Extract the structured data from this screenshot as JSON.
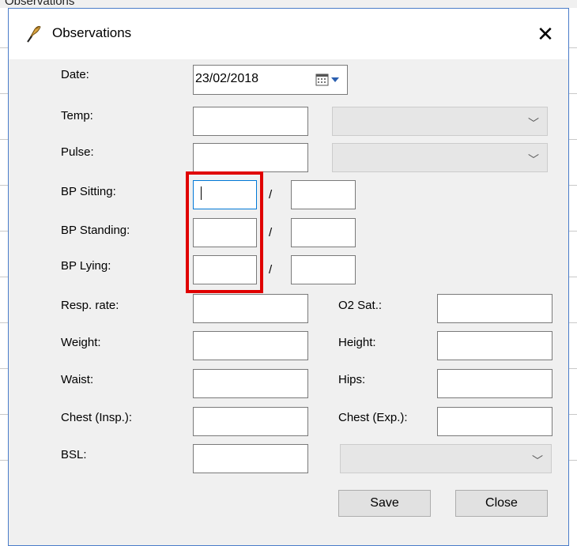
{
  "window": {
    "title": "Observations",
    "close_symbol": "✕",
    "background_caption": "Observations"
  },
  "labels": {
    "date": "Date:",
    "temp": "Temp:",
    "pulse": "Pulse:",
    "bp_sitting": "BP Sitting:",
    "bp_standing": "BP Standing:",
    "bp_lying": "BP Lying:",
    "resp_rate": "Resp. rate:",
    "weight": "Weight:",
    "waist": "Waist:",
    "chest_insp": "Chest (Insp.):",
    "bsl": "BSL:",
    "o2_sat": "O2 Sat.:",
    "height": "Height:",
    "hips": "Hips:",
    "chest_exp": "Chest (Exp.):"
  },
  "date": {
    "value": "23/02/2018"
  },
  "separator": "/",
  "buttons": {
    "save": "Save",
    "close": "Close"
  },
  "colors": {
    "highlight": "#e00000",
    "dialog_border": "#4a7cc9",
    "focus_border": "#0078d7"
  }
}
